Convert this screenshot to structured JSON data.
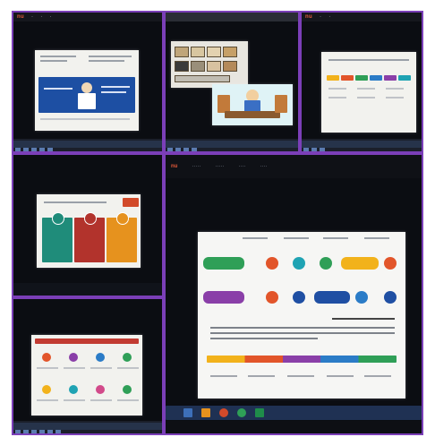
{
  "photo_grid": {
    "tiles": [
      {
        "name": "photo-top-left",
        "subject": "laptop screen with document slide"
      },
      {
        "name": "photo-top-middle",
        "subject": "laptop screen with cartoon teacher slide"
      },
      {
        "name": "photo-top-right",
        "subject": "laptop screen with timeline infographic"
      },
      {
        "name": "photo-middle-left",
        "subject": "laptop screen with three-column infographic"
      },
      {
        "name": "photo-bottom-left",
        "subject": "laptop screen with icon grid infographic"
      },
      {
        "name": "photo-large-right",
        "subject": "laptop screen with process infographic"
      }
    ],
    "border_color": "#7b3fb8"
  }
}
